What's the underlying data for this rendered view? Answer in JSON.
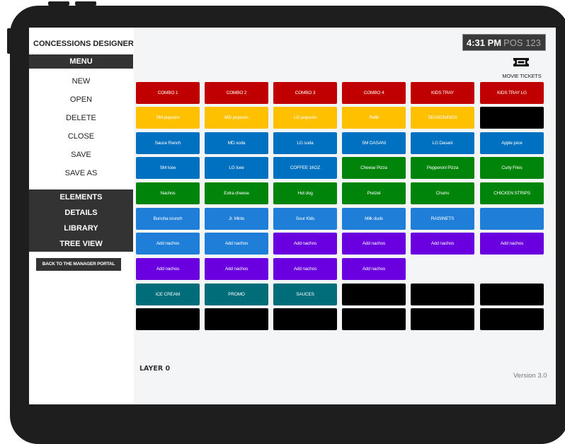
{
  "app": {
    "title": "CONCESSIONS DESIGNER"
  },
  "sidebar": {
    "menu_header": "MENU",
    "menu_items": [
      "NEW",
      "OPEN",
      "DELETE",
      "CLOSE",
      "SAVE",
      "SAVE AS"
    ],
    "sections": [
      "ELEMENTS",
      "DETAILS",
      "LIBRARY",
      "TREE VIEW"
    ],
    "back_button": "BACK TO THE MANAGER PORTAL"
  },
  "status": {
    "time": "4:31 PM",
    "pos": "POS 123"
  },
  "movie_tickets": {
    "label": "MOVIE TICKETS",
    "icon": "ticket-icon"
  },
  "colors": {
    "red": "#c00000",
    "yellow": "#ffc000",
    "blue": "#0070c0",
    "lightblue": "#1f7ed8",
    "green": "#00850a",
    "purple": "#6a00e0",
    "teal": "#006d79",
    "black": "#000000"
  },
  "grid": {
    "rows": [
      [
        {
          "label": "COMBO 1",
          "color": "red"
        },
        {
          "label": "COMBO 2",
          "color": "red"
        },
        {
          "label": "COMBO 3",
          "color": "red"
        },
        {
          "label": "COMBO 4",
          "color": "red"
        },
        {
          "label": "KIDS TRAY",
          "color": "red"
        },
        {
          "label": "KIDS TRAY LG",
          "color": "red"
        }
      ],
      [
        {
          "label": "SM popcorn",
          "color": "yellow"
        },
        {
          "label": "MD popcorn",
          "color": "yellow"
        },
        {
          "label": "LG popcorn",
          "color": "yellow"
        },
        {
          "label": "Refill",
          "color": "yellow"
        },
        {
          "label": "SEASONINGS",
          "color": "yellow"
        },
        {
          "label": "",
          "color": "black"
        }
      ],
      [
        {
          "label": "Sauce Ranch",
          "color": "blue"
        },
        {
          "label": "MD soda",
          "color": "blue"
        },
        {
          "label": "LG soda",
          "color": "blue"
        },
        {
          "label": "SM DASANI",
          "color": "blue"
        },
        {
          "label": "LG Dasani",
          "color": "blue"
        },
        {
          "label": "Apple juice",
          "color": "blue"
        }
      ],
      [
        {
          "label": "SM Icee",
          "color": "blue"
        },
        {
          "label": "LG Icee",
          "color": "blue"
        },
        {
          "label": "COFFEE 16OZ",
          "color": "blue"
        },
        {
          "label": "Cheese Pizza",
          "color": "green"
        },
        {
          "label": "Pepperoni Pizza",
          "color": "green"
        },
        {
          "label": "Curly Fries",
          "color": "green"
        }
      ],
      [
        {
          "label": "Nachos",
          "color": "green"
        },
        {
          "label": "Extra cheese",
          "color": "green"
        },
        {
          "label": "Hot dog",
          "color": "green"
        },
        {
          "label": "Pretzel",
          "color": "green"
        },
        {
          "label": "Churro",
          "color": "green"
        },
        {
          "label": "CHICKEN STRIPS",
          "color": "green"
        }
      ],
      [
        {
          "label": "Buncha crunch",
          "color": "lightblue"
        },
        {
          "label": "Jr. Mints",
          "color": "lightblue"
        },
        {
          "label": "Sour Kids",
          "color": "lightblue"
        },
        {
          "label": "Milk duds",
          "color": "lightblue"
        },
        {
          "label": "RAISINETS",
          "color": "lightblue"
        },
        {
          "label": "",
          "color": "lightblue"
        }
      ],
      [
        {
          "label": "Add nachos",
          "color": "lightblue"
        },
        {
          "label": "Add nachos",
          "color": "lightblue"
        },
        {
          "label": "Add nachos",
          "color": "purple"
        },
        {
          "label": "Add nachos",
          "color": "purple"
        },
        {
          "label": "Add nachos",
          "color": "purple"
        },
        {
          "label": "Add nachos",
          "color": "purple"
        }
      ],
      [
        {
          "label": "Add nachos",
          "color": "purple"
        },
        {
          "label": "Add nachos",
          "color": "purple"
        },
        {
          "label": "Add nachos",
          "color": "purple"
        },
        {
          "label": "Add nachos",
          "color": "purple"
        },
        null,
        null
      ],
      [
        {
          "label": "ICE CREAM",
          "color": "teal"
        },
        {
          "label": "PROMO",
          "color": "teal"
        },
        {
          "label": "SAUCES",
          "color": "teal"
        },
        {
          "label": "",
          "color": "black"
        },
        {
          "label": "",
          "color": "black"
        },
        {
          "label": "",
          "color": "black"
        }
      ],
      [
        {
          "label": "",
          "color": "black"
        },
        {
          "label": "",
          "color": "black"
        },
        {
          "label": "",
          "color": "black"
        },
        {
          "label": "",
          "color": "black"
        },
        {
          "label": "",
          "color": "black"
        },
        {
          "label": "",
          "color": "black"
        }
      ]
    ]
  },
  "footer": {
    "layer": "LAYER 0",
    "version": "Version 3.0"
  }
}
